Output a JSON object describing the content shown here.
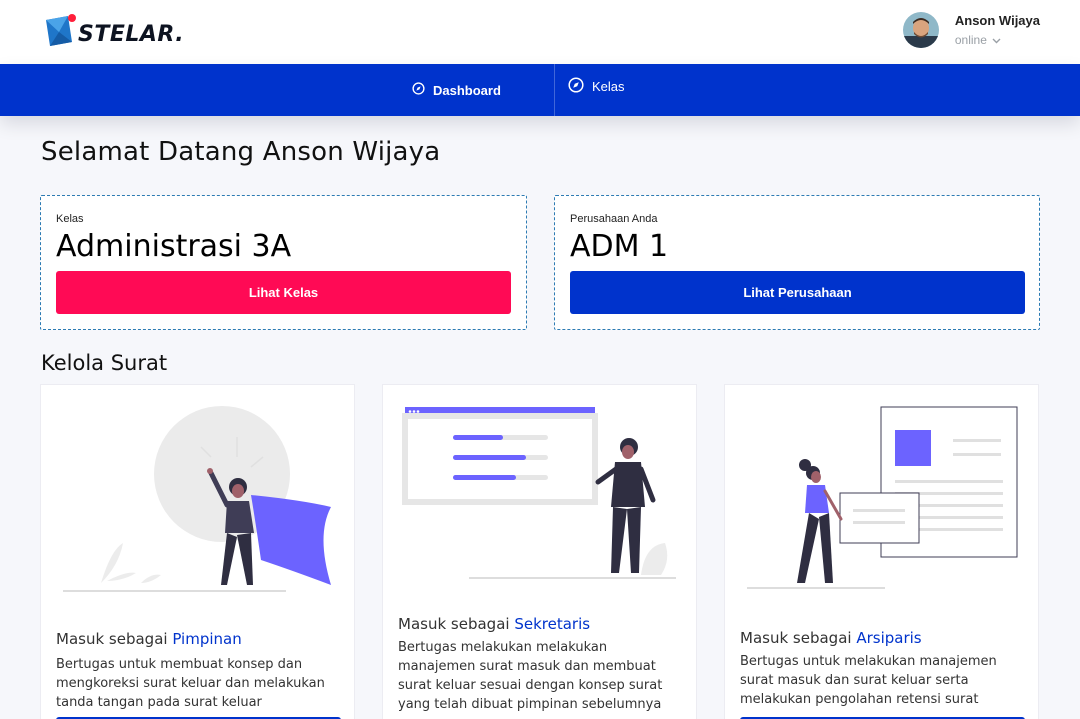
{
  "brand": {
    "name": "STELAR."
  },
  "user": {
    "name": "Anson Wijaya",
    "status": "online"
  },
  "nav": {
    "dashboard": "Dashboard",
    "kelas": "Kelas"
  },
  "welcome": "Selamat Datang Anson Wijaya",
  "class_card": {
    "label": "Kelas",
    "value": "Administrasi 3A",
    "button": "Lihat Kelas"
  },
  "company_card": {
    "label": "Perusahaan Anda",
    "value": "ADM 1",
    "button": "Lihat Perusahaan"
  },
  "section_title": "Kelola Surat",
  "roles": [
    {
      "prefix": "Masuk sebagai ",
      "role": "Pimpinan",
      "desc": "Bertugas untuk membuat konsep dan mengkoreksi surat keluar dan melakukan tanda tangan pada surat keluar"
    },
    {
      "prefix": "Masuk sebagai ",
      "role": "Sekretaris",
      "desc": "Bertugas melakukan melakukan manajemen surat masuk dan membuat surat keluar sesuai dengan konsep surat yang telah dibuat pimpinan sebelumnya"
    },
    {
      "prefix": "Masuk sebagai ",
      "role": "Arsiparis",
      "desc": "Bertugas untuk melakukan manajemen surat masuk dan surat keluar serta melakukan pengolahan retensi surat"
    }
  ],
  "colors": {
    "primary": "#0033cc",
    "accent_red": "#ff0a55",
    "illustration_purple": "#6c63ff"
  },
  "icons": {
    "logo": "envelope-logo-icon",
    "dashboard": "compass-icon",
    "kelas": "compass-icon",
    "status": "chevron-down-icon"
  }
}
